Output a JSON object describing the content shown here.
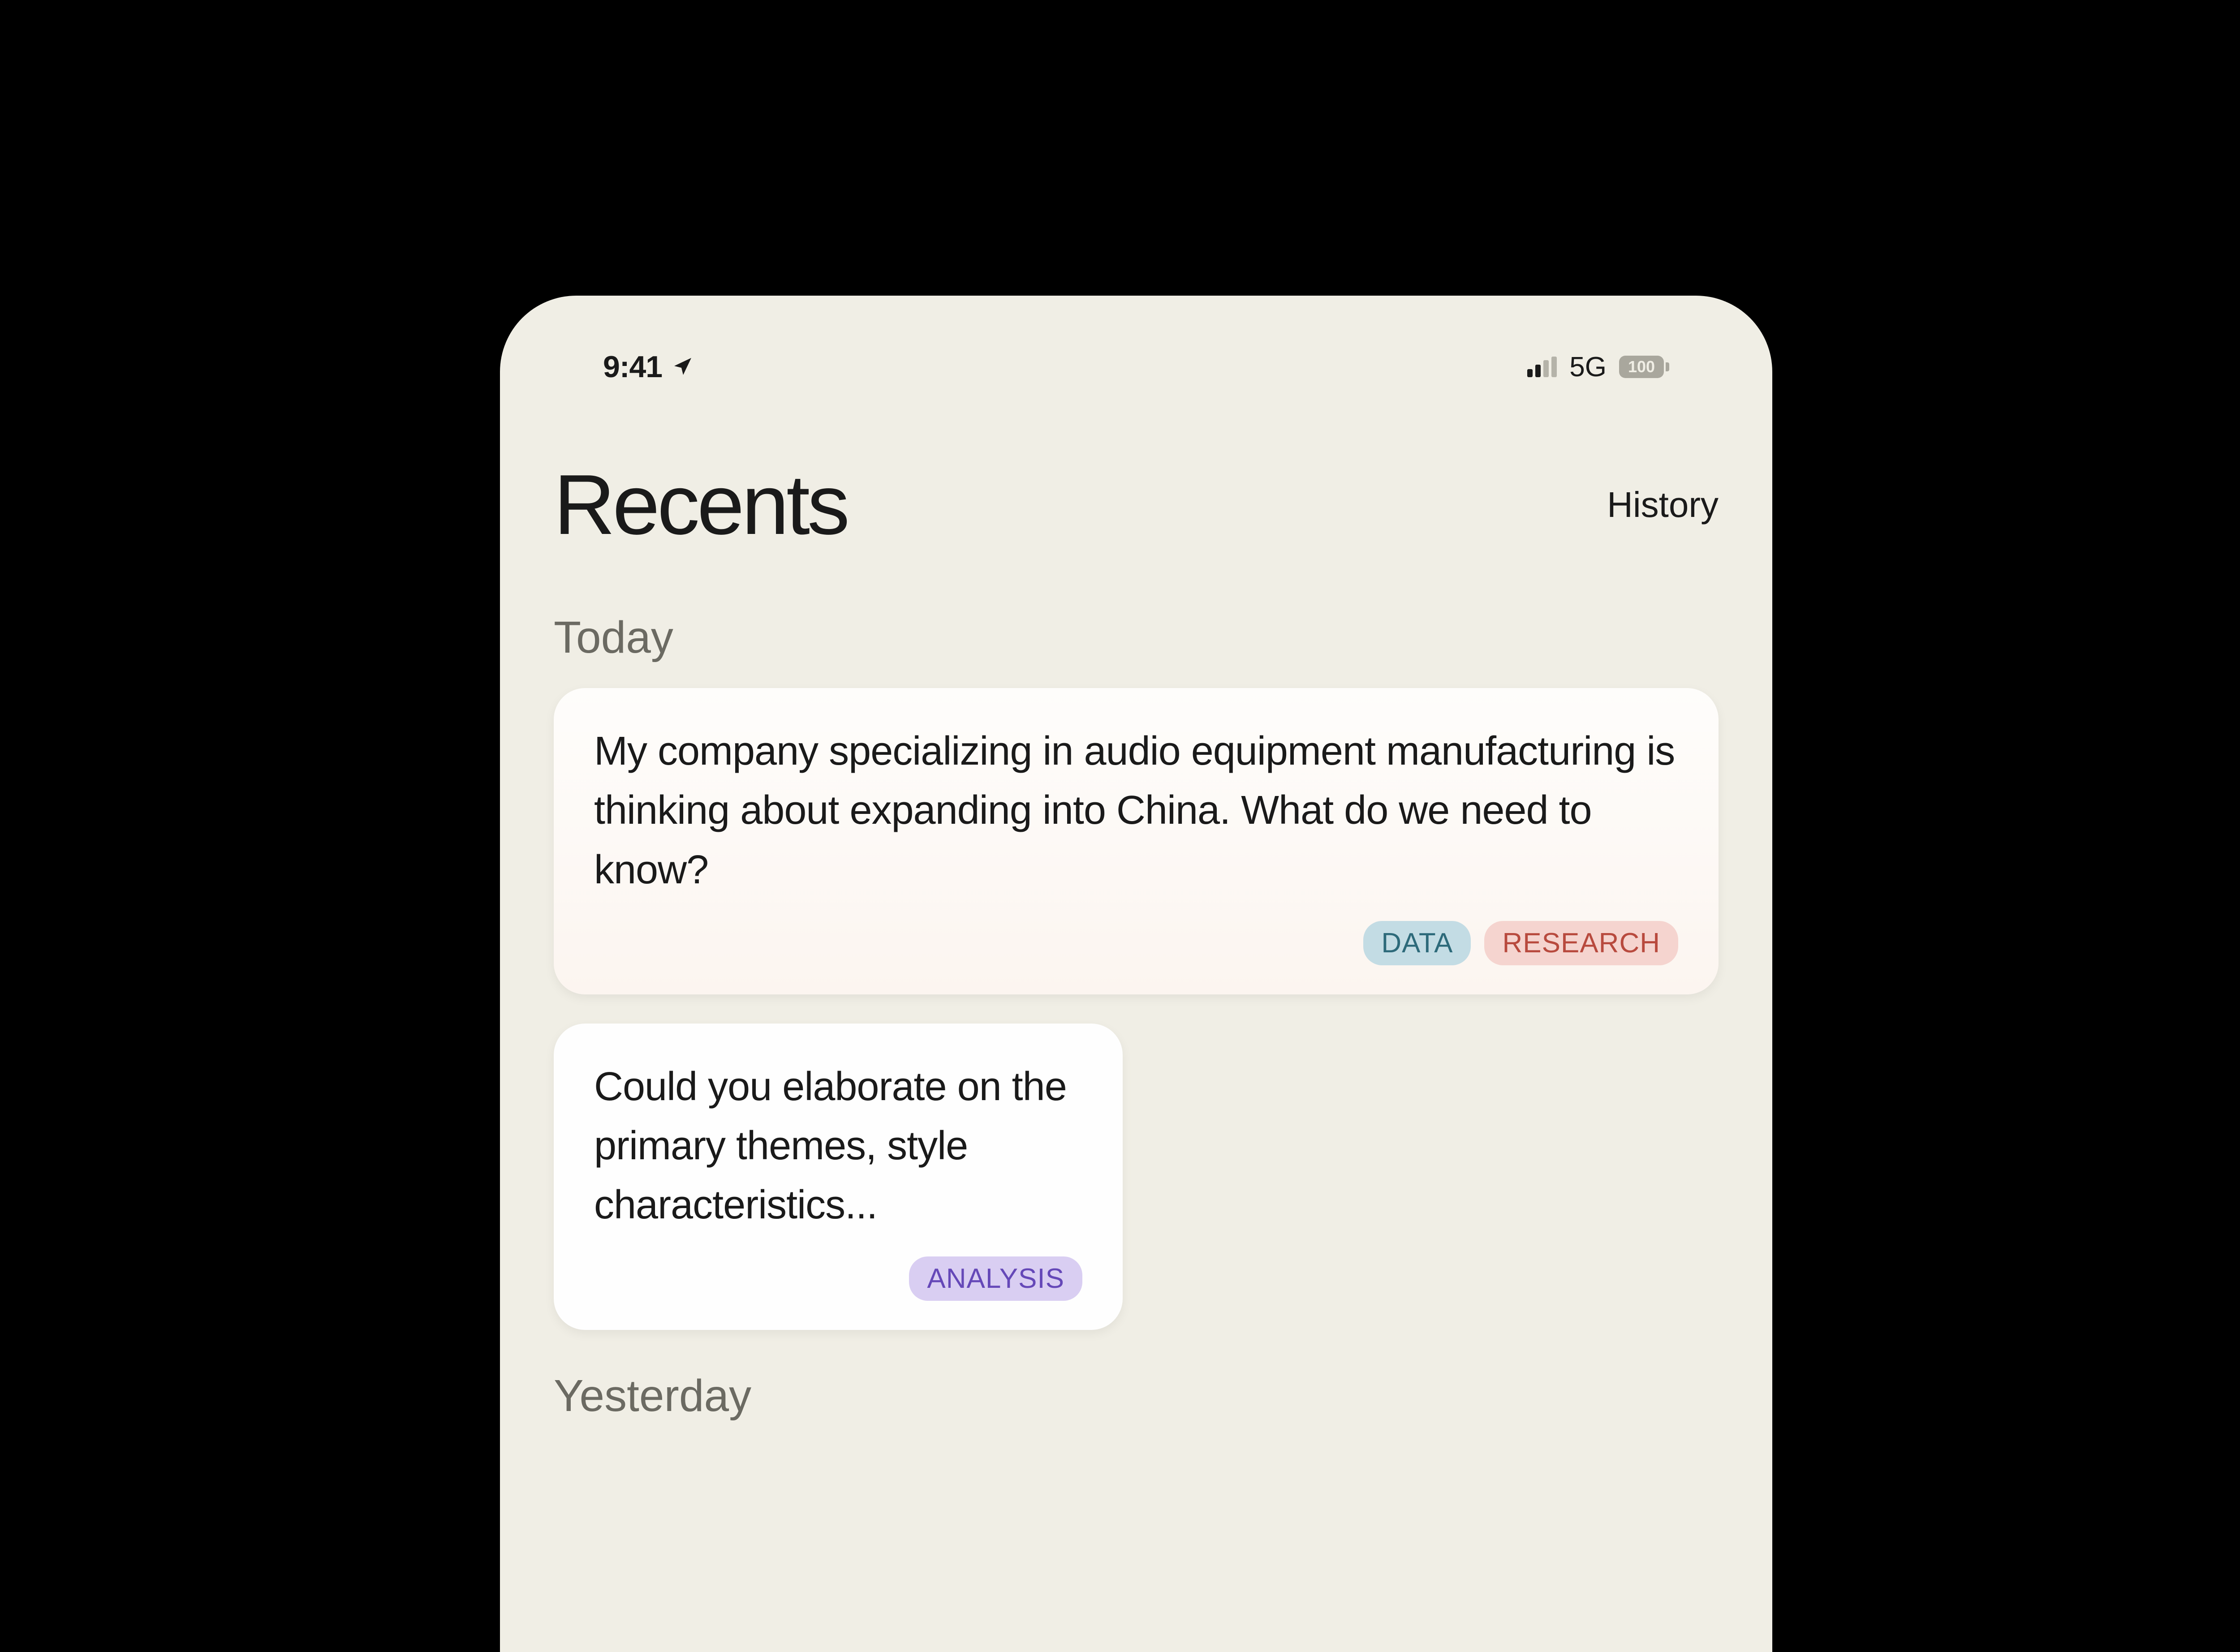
{
  "status": {
    "time": "9:41",
    "network": "5G",
    "battery": "100"
  },
  "header": {
    "title": "Recents",
    "link": "History"
  },
  "sections": [
    {
      "title": "Today",
      "cards": [
        {
          "text": "My company specializing in audio equipment manufacturing is thinking about expanding into China. What do we need to know?",
          "tags": [
            "DATA",
            "RESEARCH"
          ]
        },
        {
          "text": "Could you elaborate on the primary themes, style characteristics...",
          "tags": [
            "ANALYSIS"
          ]
        }
      ]
    },
    {
      "title": "Yesterday",
      "cards": []
    }
  ],
  "tagStyles": {
    "DATA": "data",
    "RESEARCH": "research",
    "ANALYSIS": "analysis"
  }
}
